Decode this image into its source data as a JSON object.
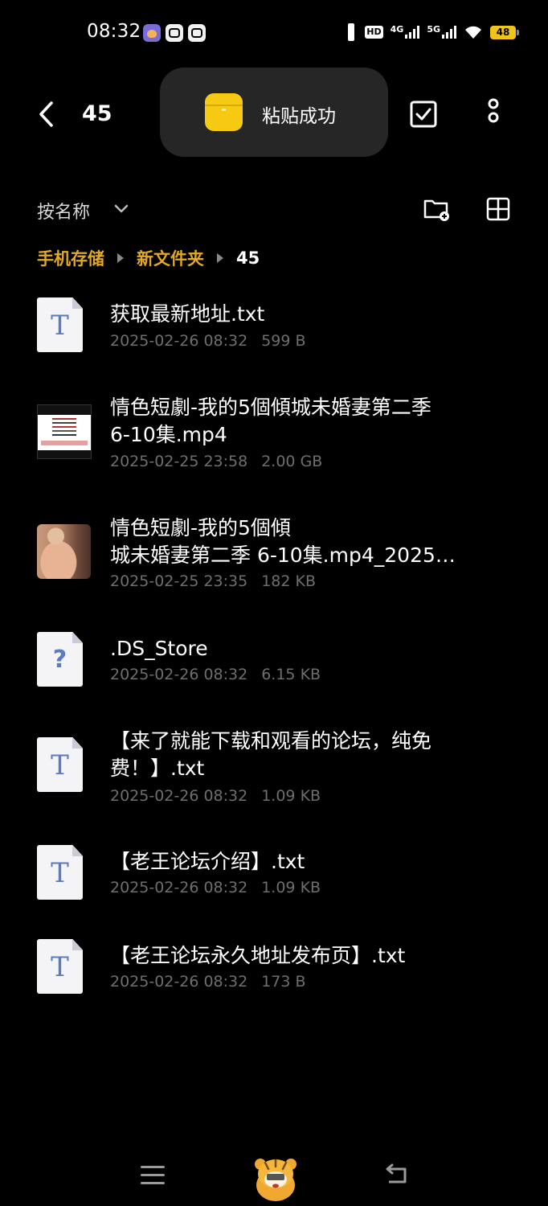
{
  "status_bar": {
    "time": "08:32",
    "notification_icons": [
      "game-app-icon",
      "gamepad-icon",
      "gamepad-icon"
    ],
    "hd_label": "HD",
    "network_1": "4G",
    "network_2": "5G",
    "battery": "48",
    "battery_color": "#f0c419"
  },
  "header": {
    "back_icon": "chevron-left-icon",
    "title": "45",
    "select_icon": "checkbox-icon",
    "more_icon": "more-vertical-icon"
  },
  "toast": {
    "text": "粘贴成功",
    "icon": "clipboard-folder-icon",
    "icon_color": "#f6c913",
    "background": "#262626"
  },
  "toolbar": {
    "sort_label": "按名称",
    "sort_icon": "chevron-down-icon",
    "new_folder_icon": "new-folder-icon",
    "view_icon": "grid-view-icon"
  },
  "breadcrumb": {
    "items": [
      "手机存储",
      "新文件夹",
      "45"
    ],
    "accent_color": "#e3a91f"
  },
  "files": [
    {
      "icon": "text-file-icon",
      "glyph": "T",
      "name": "获取最新地址.txt",
      "date": "2025-02-26 08:32",
      "size": "599 B"
    },
    {
      "icon": "video-thumbnail",
      "name": "情色短劇-我的5個傾城未婚妻第二季\n6-10集.mp4",
      "date": "2025-02-25 23:58",
      "size": "2.00 GB"
    },
    {
      "icon": "image-thumbnail",
      "name": "情色短劇-我的5個傾\n城未婚妻第二季 6-10集.mp4_2025…",
      "date": "2025-02-25 23:35",
      "size": "182 KB"
    },
    {
      "icon": "unknown-file-icon",
      "glyph": "?",
      "name": ".DS_Store",
      "date": "2025-02-26 08:32",
      "size": "6.15 KB"
    },
    {
      "icon": "text-file-icon",
      "glyph": "T",
      "name": "【来了就能下载和观看的论坛，纯免\n费！】.txt",
      "date": "2025-02-26 08:32",
      "size": "1.09 KB"
    },
    {
      "icon": "text-file-icon",
      "glyph": "T",
      "name": "【老王论坛介绍】.txt",
      "date": "2025-02-26 08:32",
      "size": "1.09 KB"
    },
    {
      "icon": "text-file-icon",
      "glyph": "T",
      "name": "【老王论坛永久地址发布页】.txt",
      "date": "2025-02-26 08:32",
      "size": "173 B"
    }
  ],
  "nav_bar": {
    "menu_icon": "menu-icon",
    "home_icon": "tiger-mascot-icon",
    "back_icon": "return-icon"
  }
}
